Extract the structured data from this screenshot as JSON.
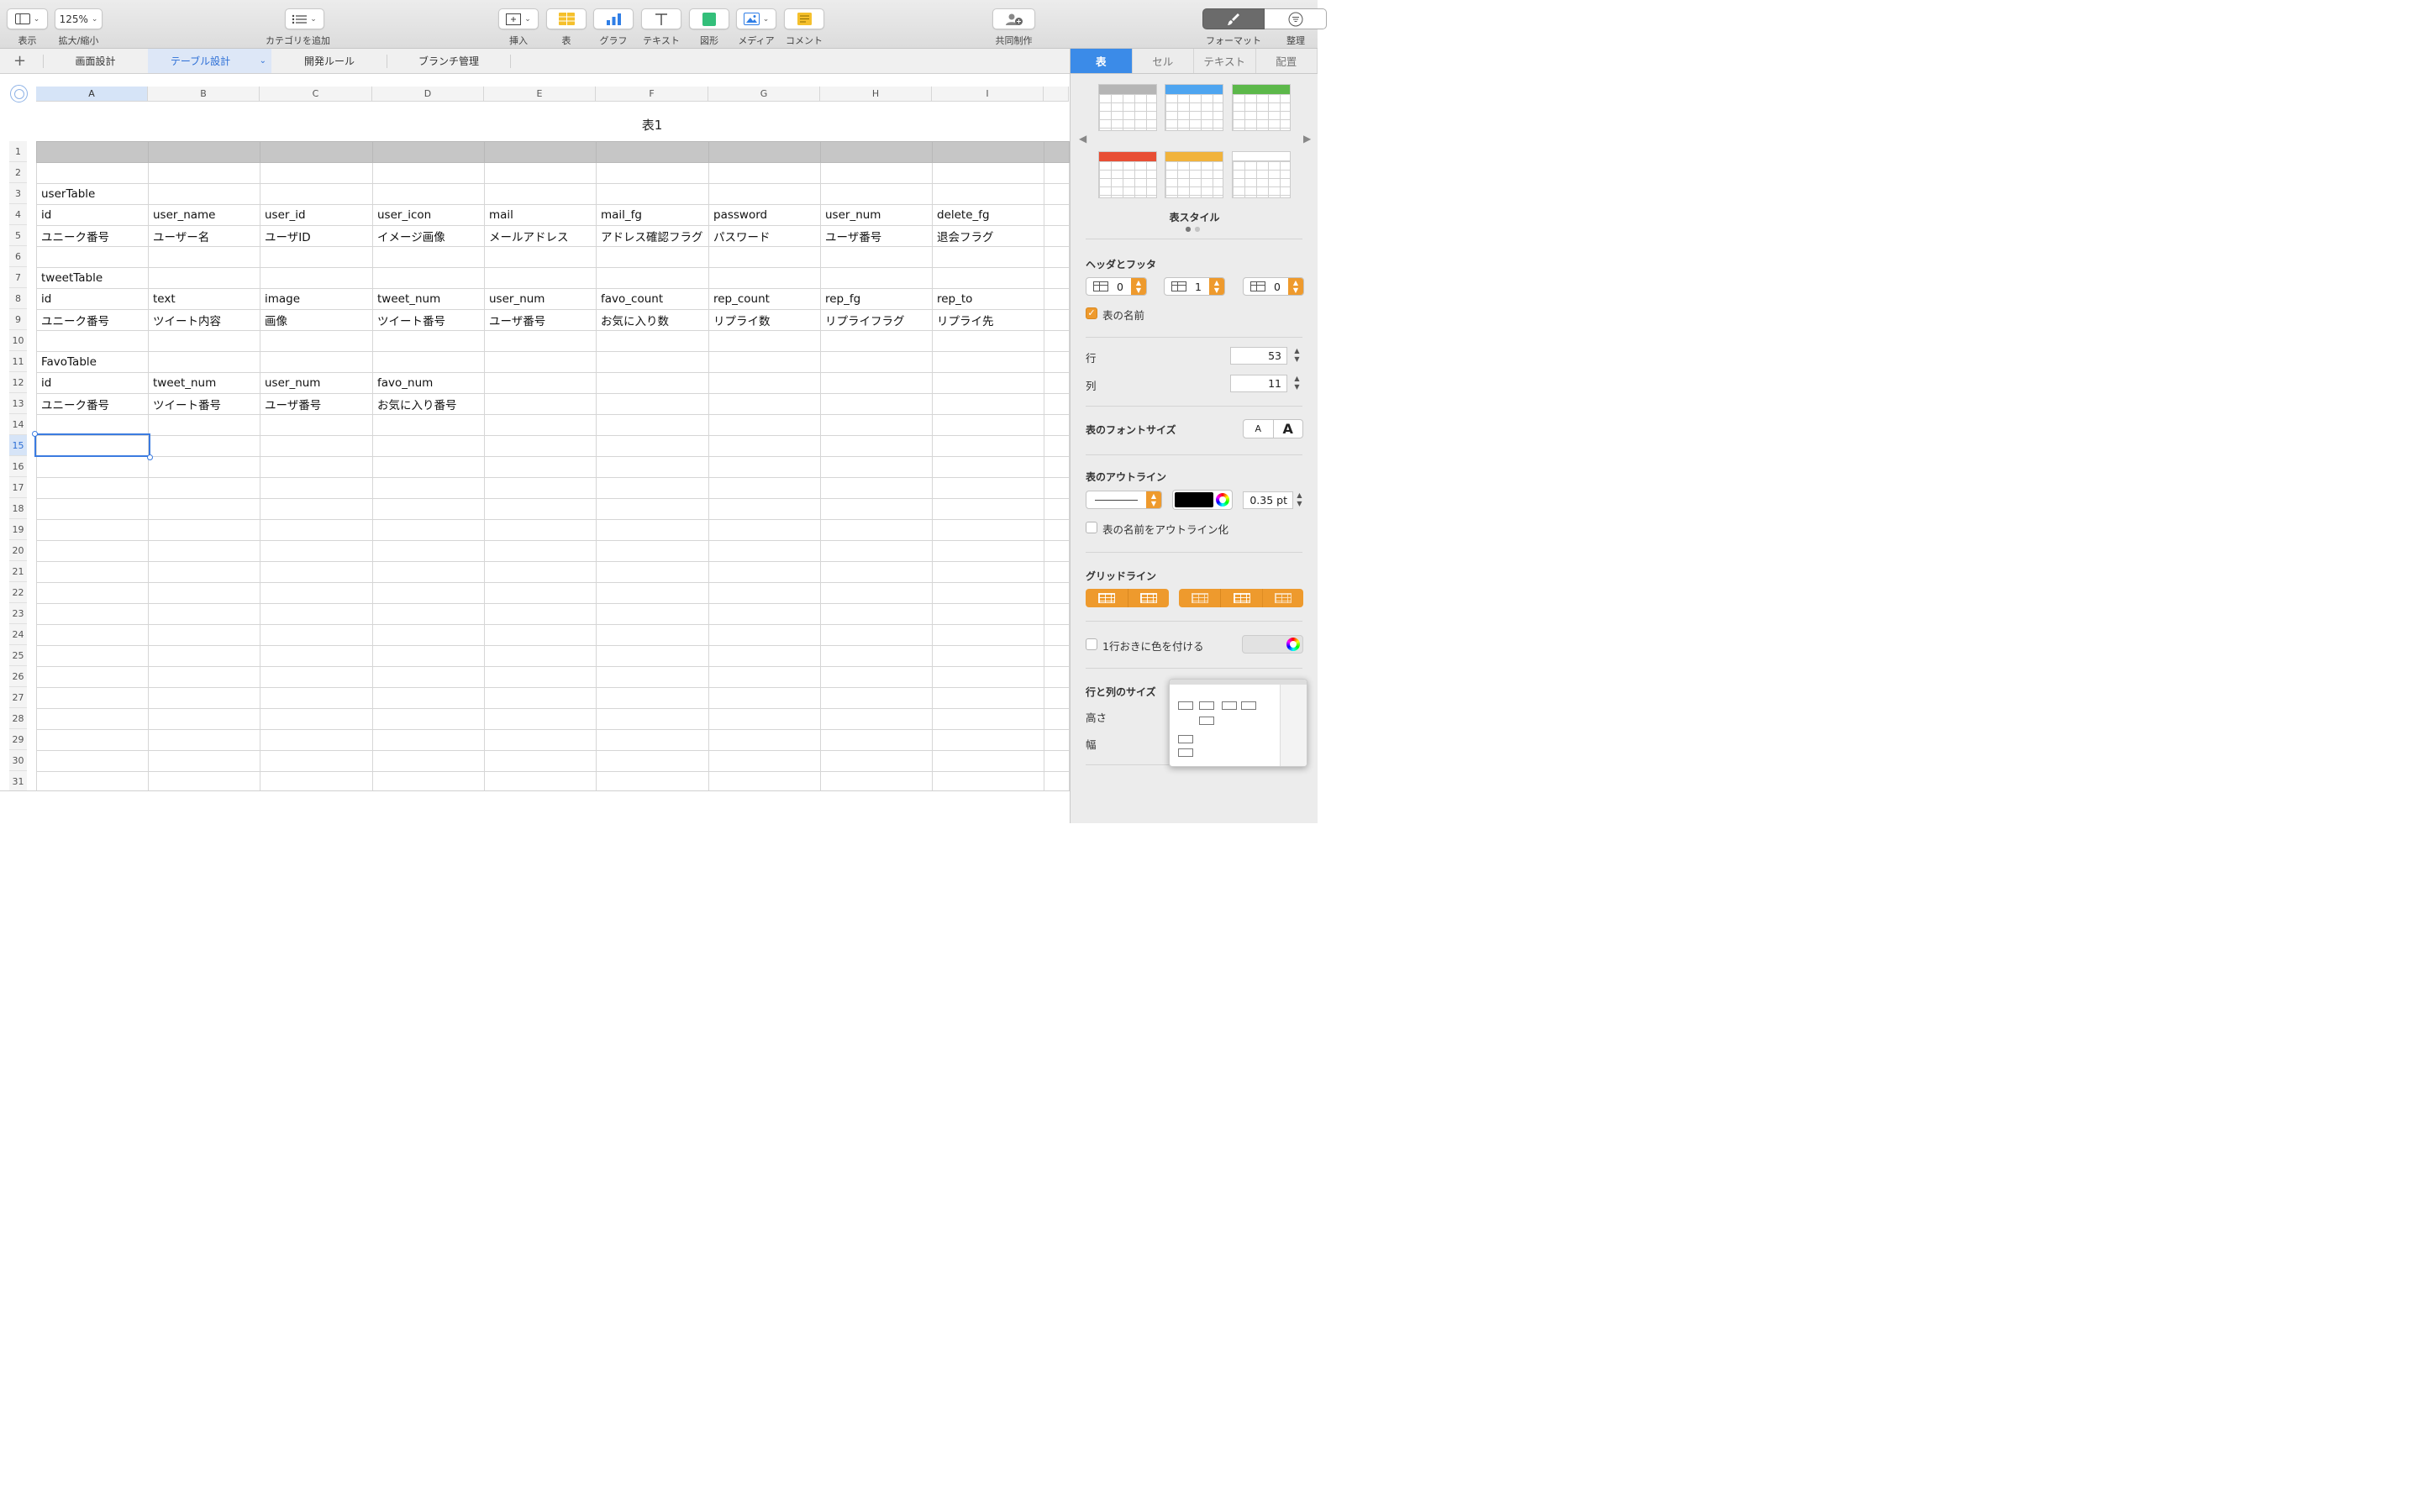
{
  "toolbar": {
    "view_label": "表示",
    "zoom_value": "125%",
    "zoom_label": "拡大/縮小",
    "category_label": "カテゴリを追加",
    "insert_label": "挿入",
    "table_label": "表",
    "chart_label": "グラフ",
    "text_label": "テキスト",
    "shape_label": "図形",
    "media_label": "メディア",
    "comment_label": "コメント",
    "collab_label": "共同制作",
    "format_label": "フォーマット",
    "organize_label": "整理"
  },
  "sheets": {
    "add": "+",
    "tabs": [
      {
        "label": "画面設計"
      },
      {
        "label": "テーブル設計"
      },
      {
        "label": "開発ルール"
      },
      {
        "label": "ブランチ管理"
      }
    ]
  },
  "spreadsheet": {
    "table_title": "表1",
    "columns": [
      "A",
      "B",
      "C",
      "D",
      "E",
      "F",
      "G",
      "H",
      "I"
    ],
    "selected_column": "A",
    "selected_row": 15,
    "rows": [
      [
        "",
        "",
        "",
        "",
        "",
        "",
        "",
        "",
        ""
      ],
      [
        "",
        "",
        "",
        "",
        "",
        "",
        "",
        "",
        ""
      ],
      [
        "userTable",
        "",
        "",
        "",
        "",
        "",
        "",
        "",
        ""
      ],
      [
        "id",
        "user_name",
        "user_id",
        "user_icon",
        "mail",
        "mail_fg",
        "password",
        "user_num",
        "delete_fg"
      ],
      [
        "ユニーク番号",
        "ユーザー名",
        "ユーザID",
        "イメージ画像",
        "メールアドレス",
        "アドレス確認フラグ",
        "パスワード",
        "ユーザ番号",
        "退会フラグ"
      ],
      [
        "",
        "",
        "",
        "",
        "",
        "",
        "",
        "",
        ""
      ],
      [
        "tweetTable",
        "",
        "",
        "",
        "",
        "",
        "",
        "",
        ""
      ],
      [
        "id",
        "text",
        "image",
        "tweet_num",
        "user_num",
        "favo_count",
        "rep_count",
        "rep_fg",
        "rep_to"
      ],
      [
        "ユニーク番号",
        "ツイート内容",
        "画像",
        "ツイート番号",
        "ユーザ番号",
        "お気に入り数",
        "リプライ数",
        "リプライフラグ",
        "リプライ先"
      ],
      [
        "",
        "",
        "",
        "",
        "",
        "",
        "",
        "",
        ""
      ],
      [
        "FavoTable",
        "",
        "",
        "",
        "",
        "",
        "",
        "",
        ""
      ],
      [
        "id",
        "tweet_num",
        "user_num",
        "favo_num",
        "",
        "",
        "",
        "",
        ""
      ],
      [
        "ユニーク番号",
        "ツイート番号",
        "ユーザ番号",
        "お気に入り番号",
        "",
        "",
        "",
        "",
        ""
      ]
    ],
    "row_count_visible": 31
  },
  "inspector": {
    "tabs": [
      {
        "label": "表",
        "active": true
      },
      {
        "label": "セル",
        "active": false
      },
      {
        "label": "テキスト",
        "active": false
      },
      {
        "label": "配置",
        "active": false
      }
    ],
    "style_colors": [
      "#b5b5b5",
      "#4ea5f0",
      "#5cb84a",
      "#e84e34",
      "#f1b33c",
      "#ffffff"
    ],
    "styles_label": "表スタイル",
    "header_footer_title": "ヘッダとフッタ",
    "header_rows": "0",
    "header_cols": "1",
    "footer_rows": "0",
    "table_name_label": "表の名前",
    "table_name_checked": true,
    "rows_label": "行",
    "rows_value": "53",
    "cols_label": "列",
    "cols_value": "11",
    "font_size_title": "表のフォントサイズ",
    "font_small": "A",
    "font_large": "A",
    "outline_title": "表のアウトライン",
    "outline_color": "#000000",
    "outline_width": "0.35 pt",
    "outline_name_label": "表の名前をアウトライン化",
    "gridlines_title": "グリッドライン",
    "alternate_label": "1行おきに色を付ける",
    "size_title": "行と列のサイズ",
    "height_label": "高さ",
    "width_label": "幅"
  }
}
